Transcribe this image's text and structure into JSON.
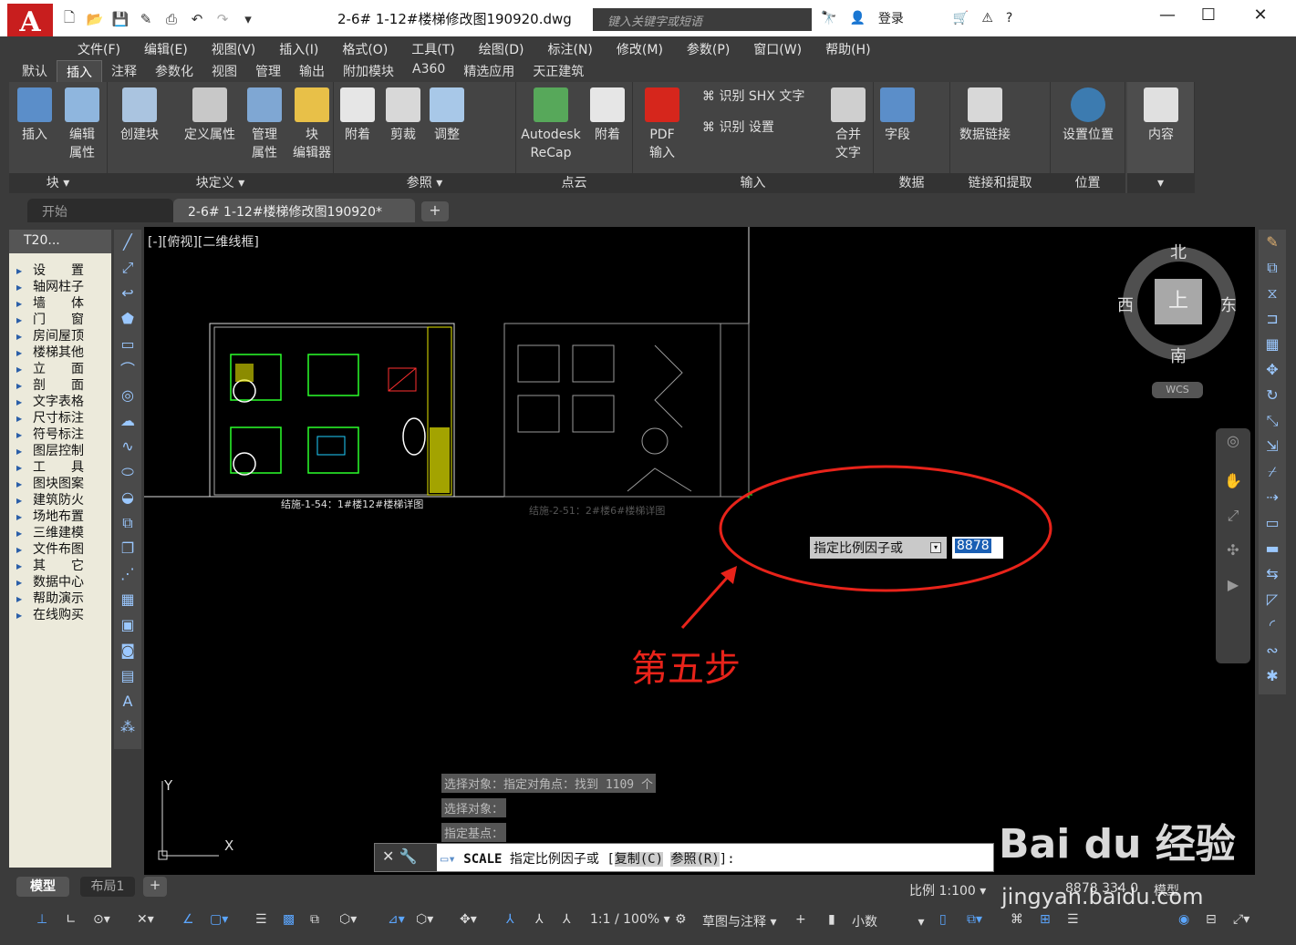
{
  "app": {
    "logo": "A",
    "title": "2-6# 1-12#楼梯修改图190920.dwg",
    "search_placeholder": "键入关键字或短语",
    "login": "登录"
  },
  "window_controls": {
    "minimize": "—",
    "maximize": "☐",
    "close": "✕"
  },
  "menus": [
    "文件(F)",
    "编辑(E)",
    "视图(V)",
    "插入(I)",
    "格式(O)",
    "工具(T)",
    "绘图(D)",
    "标注(N)",
    "修改(M)",
    "参数(P)",
    "窗口(W)",
    "帮助(H)"
  ],
  "ribbon_tabs": [
    "默认",
    "插入",
    "注释",
    "参数化",
    "视图",
    "管理",
    "输出",
    "附加模块",
    "A360",
    "精选应用",
    "天正建筑"
  ],
  "active_ribbon_tab": "插入",
  "panels": {
    "block": {
      "title": "块 ▾",
      "buttons": [
        "插入",
        "编辑\n属性"
      ]
    },
    "block_def": {
      "title": "块定义 ▾",
      "buttons": [
        "创建块",
        "定义属性",
        "管理\n属性",
        "块\n编辑器"
      ]
    },
    "reference": {
      "title": "参照 ▾",
      "buttons": [
        "附着",
        "剪裁",
        "调整"
      ]
    },
    "pointcloud": {
      "title": "点云",
      "buttons": [
        "Autodesk\nReCap",
        "附着"
      ]
    },
    "import": {
      "title": "输入",
      "buttons": [
        "PDF\n输入",
        "识别 SHX 文字",
        "识别 设置",
        "合并\n文字"
      ]
    },
    "data": {
      "title": "数据",
      "buttons": [
        "字段"
      ]
    },
    "link": {
      "title": "链接和提取",
      "buttons": [
        "数据链接"
      ]
    },
    "location": {
      "title": "位置",
      "buttons": [
        "设置位置"
      ]
    },
    "content": {
      "title": "",
      "buttons": [
        "内容"
      ]
    }
  },
  "doc_tabs": {
    "start": "开始",
    "active": "2-6# 1-12#楼梯修改图190920*"
  },
  "left_palette": {
    "title": "T20...",
    "items": [
      "设　　置",
      "轴网柱子",
      "墙　　体",
      "门　　窗",
      "房间屋顶",
      "楼梯其他",
      "立　　面",
      "剖　　面",
      "文字表格",
      "尺寸标注",
      "符号标注",
      "图层控制",
      "工　　具",
      "图块图案",
      "建筑防火",
      "场地布置",
      "三维建模",
      "文件布图",
      "其　　它",
      "数据中心",
      "帮助演示",
      "在线购买"
    ]
  },
  "viewport": {
    "label": "[-][俯视][二维线框]",
    "compass": {
      "north": "北",
      "south": "南",
      "east": "东",
      "west": "西",
      "top": "上",
      "wcs": "WCS"
    }
  },
  "drawings": {
    "left_caption": "结施-1-54：1#楼12#楼梯详图",
    "right_caption": "结施-2-51：2#楼6#楼梯详图"
  },
  "prompt": {
    "label": "指定比例因子或",
    "value": "8878"
  },
  "annotation": {
    "text": "第五步",
    "color": "#e8231a"
  },
  "command_history": [
    "选择对象：指定对角点：找到 1109 个",
    "选择对象：",
    "指定基点："
  ],
  "command_line": {
    "cmd": "SCALE",
    "text": "指定比例因子或 [",
    "opt1": "复制(C)",
    "opt2": "参照(R)",
    "end": "]:"
  },
  "layout_tabs": [
    "模型",
    "布局1"
  ],
  "status": {
    "scale": "比例 1:100",
    "coords": "8878 334 0",
    "model": "模型",
    "zoom": "1:1 / 100%",
    "workspace": "草图与注释",
    "units": "小数"
  },
  "watermark": {
    "text": "Bai du 经验",
    "url": "jingyan.baidu.com"
  },
  "ucs": {
    "x": "X",
    "y": "Y"
  }
}
